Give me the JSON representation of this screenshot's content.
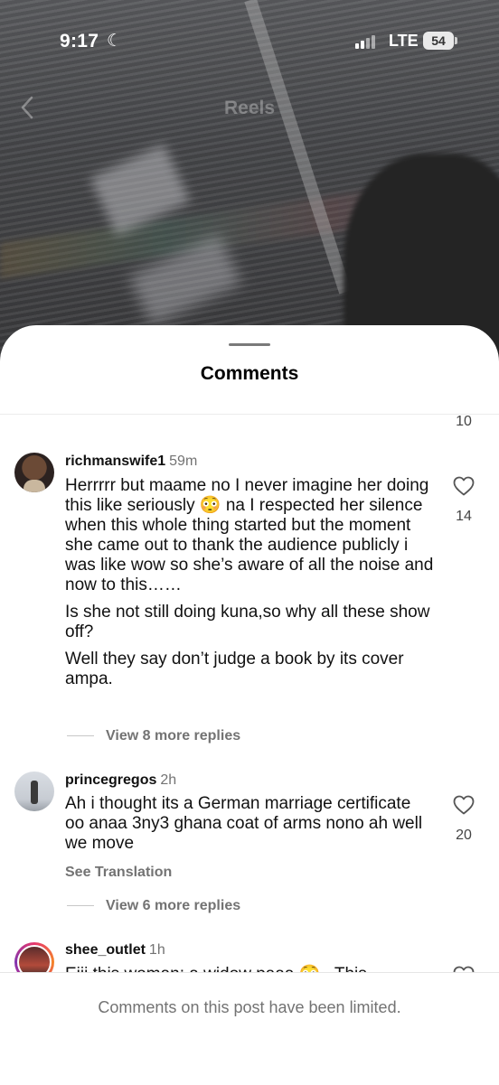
{
  "status_bar": {
    "time": "9:17",
    "network": "LTE",
    "battery": "54"
  },
  "header": {
    "title": "Reels"
  },
  "sheet": {
    "title": "Comments",
    "previous_comment_likes": "10",
    "comments": [
      {
        "username": "richmanswife1",
        "time": "59m",
        "paragraphs": [
          "Herrrrr but maame no I never imagine her doing this like seriously 😳 na I respected her silence when this whole thing started but the moment she came out to thank the audience publicly i was like wow so she’s aware of all the noise and now to this……",
          "Is she not still doing kuna,so why all these show off?",
          "Well they say don’t judge a book by its cover ampa."
        ],
        "likes": "14",
        "view_replies": "View 8 more replies"
      },
      {
        "username": "princegregos",
        "time": "2h",
        "paragraphs": [
          "Ah i thought its a German marriage certificate oo anaa 3ny3 ghana coat of arms nono ah well we move"
        ],
        "likes": "20",
        "see_translation": "See Translation",
        "view_replies": "View 6 more replies"
      },
      {
        "username": "shee_outlet",
        "time": "1h",
        "paragraphs": [
          "Eiii this woman: a widow paaa 😳 . This"
        ]
      }
    ]
  },
  "footer": {
    "text": "Comments on this post have been limited."
  },
  "colors": {
    "text_primary": "#111111",
    "text_secondary": "#737373",
    "sheet_background": "#ffffff"
  }
}
